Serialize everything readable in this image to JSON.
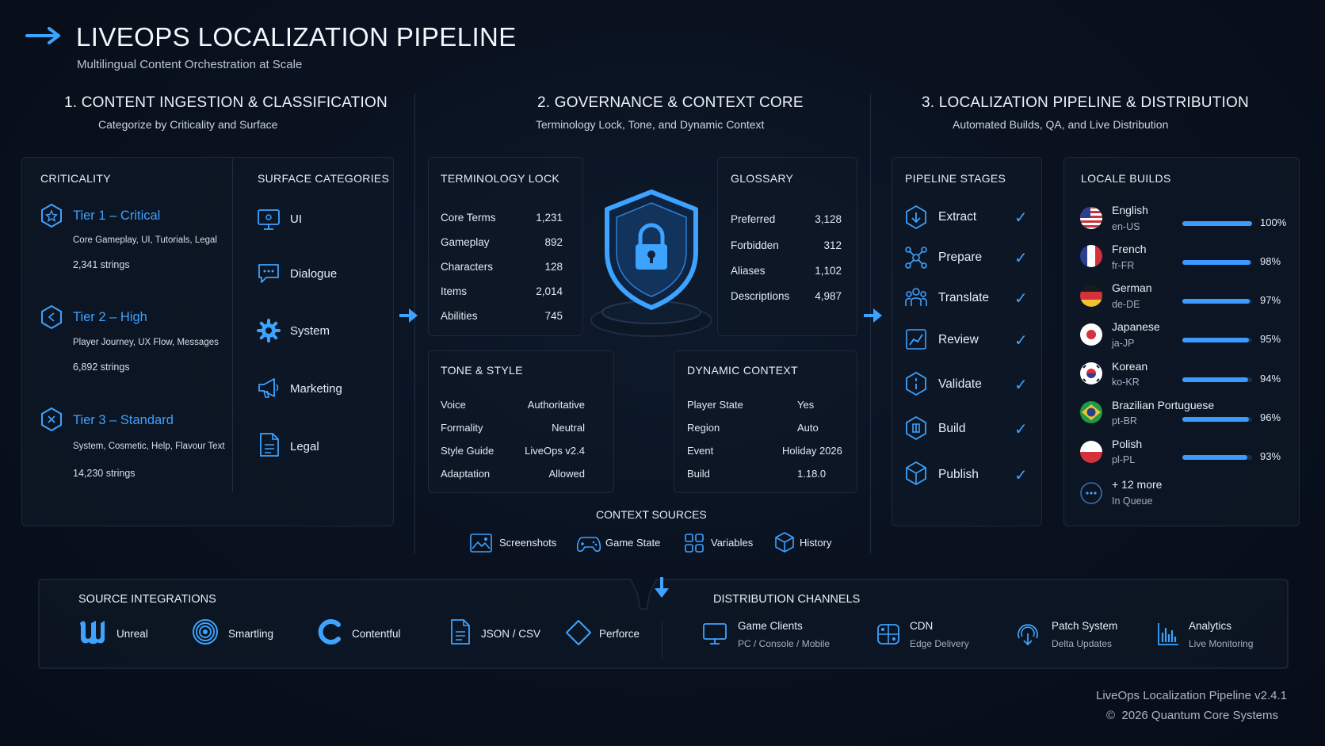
{
  "header": {
    "title": "LIVEOPS LOCALIZATION PIPELINE",
    "subtitle": "Multilingual Content Orchestration at Scale"
  },
  "sections": {
    "ingestion": {
      "title": "1. CONTENT INGESTION & CLASSIFICATION",
      "subtitle": "Categorize by Criticality and Surface"
    },
    "governance": {
      "title": "2. GOVERNANCE & CONTEXT CORE",
      "subtitle": "Terminology Lock, Tone, and Dynamic Context"
    },
    "pipeline": {
      "title": "3. LOCALIZATION PIPELINE & DISTRIBUTION",
      "subtitle": "Automated Builds, QA, and Live Distribution"
    }
  },
  "criticality": {
    "title": "CRITICALITY",
    "tiers": [
      {
        "name": "Tier 1 – Critical",
        "desc": "Core Gameplay, UI, Tutorials, Legal",
        "count": "2,341 strings",
        "icon": "hexagon-star-icon"
      },
      {
        "name": "Tier 2 – High",
        "desc": "Player Journey, UX Flow, Messages",
        "count": "6,892 strings",
        "icon": "hexagon-icon"
      },
      {
        "name": "Tier 3 – Standard",
        "desc": "System, Cosmetic, Help, Flavour Text",
        "count": "14,230 strings",
        "icon": "hexagon-icon"
      }
    ]
  },
  "surfaces": {
    "title": "SURFACE CATEGORIES",
    "items": [
      {
        "label": "UI",
        "icon": "monitor-icon"
      },
      {
        "label": "Dialogue",
        "icon": "chat-bubble-icon"
      },
      {
        "label": "System",
        "icon": "gear-icon"
      },
      {
        "label": "Marketing",
        "icon": "megaphone-icon"
      },
      {
        "label": "Legal",
        "icon": "document-icon"
      }
    ]
  },
  "terminology": {
    "title": "TERMINOLOGY LOCK",
    "rows": [
      {
        "k": "Core Terms",
        "v": "1,231"
      },
      {
        "k": "Gameplay",
        "v": "892"
      },
      {
        "k": "Characters",
        "v": "128"
      },
      {
        "k": "Items",
        "v": "2,014"
      },
      {
        "k": "Abilities",
        "v": "745"
      }
    ]
  },
  "glossary": {
    "title": "GLOSSARY",
    "rows": [
      {
        "k": "Preferred",
        "v": "3,128"
      },
      {
        "k": "Forbidden",
        "v": "312"
      },
      {
        "k": "Aliases",
        "v": "1,102"
      },
      {
        "k": "Descriptions",
        "v": "4,987"
      }
    ]
  },
  "tone": {
    "title": "TONE & STYLE",
    "rows": [
      {
        "k": "Voice",
        "v": "Authoritative"
      },
      {
        "k": "Formality",
        "v": "Neutral"
      },
      {
        "k": "Style Guide",
        "v": "LiveOps v2.4"
      },
      {
        "k": "Adaptation",
        "v": "Allowed"
      }
    ]
  },
  "dynamic": {
    "title": "DYNAMIC CONTEXT",
    "rows": [
      {
        "k": "Player State",
        "v": "Yes"
      },
      {
        "k": "Region",
        "v": "Auto"
      },
      {
        "k": "Event",
        "v": "Holiday 2026"
      },
      {
        "k": "Build",
        "v": "1.18.0"
      }
    ]
  },
  "context_sources": {
    "title": "CONTEXT SOURCES",
    "items": [
      {
        "label": "Screenshots",
        "icon": "image-icon"
      },
      {
        "label": "Game State",
        "icon": "gamepad-icon"
      },
      {
        "label": "Variables",
        "icon": "grid-icon"
      },
      {
        "label": "History",
        "icon": "cube-icon"
      }
    ]
  },
  "stages": {
    "title": "PIPELINE STAGES",
    "items": [
      {
        "label": "Extract",
        "icon": "extract-icon",
        "done": true
      },
      {
        "label": "Prepare",
        "icon": "network-icon",
        "done": true
      },
      {
        "label": "Translate",
        "icon": "people-icon",
        "done": true
      },
      {
        "label": "Review",
        "icon": "chart-review-icon",
        "done": true
      },
      {
        "label": "Validate",
        "icon": "hexagon-check-icon",
        "done": true
      },
      {
        "label": "Build",
        "icon": "hexagon-build-icon",
        "done": true
      },
      {
        "label": "Publish",
        "icon": "cube-publish-icon",
        "done": true
      }
    ],
    "check_glyph": "✓"
  },
  "locales": {
    "title": "LOCALE BUILDS",
    "items": [
      {
        "name": "English",
        "code": "en-US",
        "pct": "100%",
        "progress": 1.0,
        "flag": "us-flag-icon"
      },
      {
        "name": "French",
        "code": "fr-FR",
        "pct": "98%",
        "progress": 0.98,
        "flag": "fr-flag-icon"
      },
      {
        "name": "German",
        "code": "de-DE",
        "pct": "97%",
        "progress": 0.97,
        "flag": "de-flag-icon"
      },
      {
        "name": "Japanese",
        "code": "ja-JP",
        "pct": "95%",
        "progress": 0.95,
        "flag": "jp-flag-icon"
      },
      {
        "name": "Korean",
        "code": "ko-KR",
        "pct": "94%",
        "progress": 0.94,
        "flag": "kr-flag-icon"
      },
      {
        "name": "Brazilian Portuguese",
        "code": "pt-BR",
        "pct": "96%",
        "progress": 0.96,
        "flag": "br-flag-icon"
      },
      {
        "name": "Polish",
        "code": "pl-PL",
        "pct": "93%",
        "progress": 0.93,
        "flag": "pl-flag-icon"
      }
    ],
    "more": {
      "label": "+ 12 more",
      "sub": "In Queue"
    }
  },
  "sources": {
    "title": "SOURCE INTEGRATIONS",
    "items": [
      {
        "label": "Unreal",
        "icon": "unreal-icon"
      },
      {
        "label": "Smartling",
        "icon": "smartling-icon"
      },
      {
        "label": "Contentful",
        "icon": "contentful-icon"
      },
      {
        "label": "JSON / CSV",
        "icon": "file-icon"
      },
      {
        "label": "Perforce",
        "icon": "diamond-icon"
      }
    ]
  },
  "distribution": {
    "title": "DISTRIBUTION CHANNELS",
    "items": [
      {
        "label": "Game Clients",
        "sub": "PC / Console / Mobile",
        "icon": "monitor-icon"
      },
      {
        "label": "CDN",
        "sub": "Edge Delivery",
        "icon": "cdn-icon"
      },
      {
        "label": "Patch System",
        "sub": "Delta Updates",
        "icon": "patch-icon"
      },
      {
        "label": "Analytics",
        "sub": "Live Monitoring",
        "icon": "analytics-icon"
      }
    ]
  },
  "footer": {
    "version": "LiveOps Localization Pipeline v2.4.1",
    "copyright": "©  2026 Quantum Core Systems"
  },
  "colors": {
    "accent": "#3ea2ff",
    "background": "#0a1220",
    "panel": "#0e1826"
  }
}
